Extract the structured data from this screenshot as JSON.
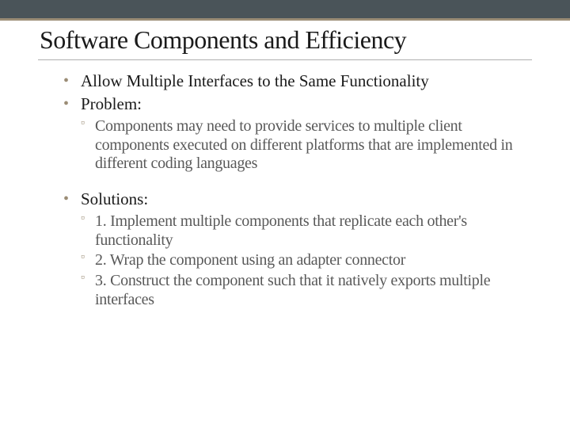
{
  "title": "Software Components and Efficiency",
  "bullets": {
    "item0": "Allow Multiple Interfaces to the Same Functionality",
    "item1": "Problem:",
    "item2": "Solutions:"
  },
  "problem_sub": {
    "s0": "Components may need to provide services to multiple client components executed on different platforms that are implemented in different coding languages"
  },
  "solutions_sub": {
    "s0": "1.  Implement multiple components that replicate each other's functionality",
    "s1": "2.  Wrap the component using an adapter connector",
    "s2": "3.  Construct  the component such that it natively exports multiple interfaces"
  }
}
